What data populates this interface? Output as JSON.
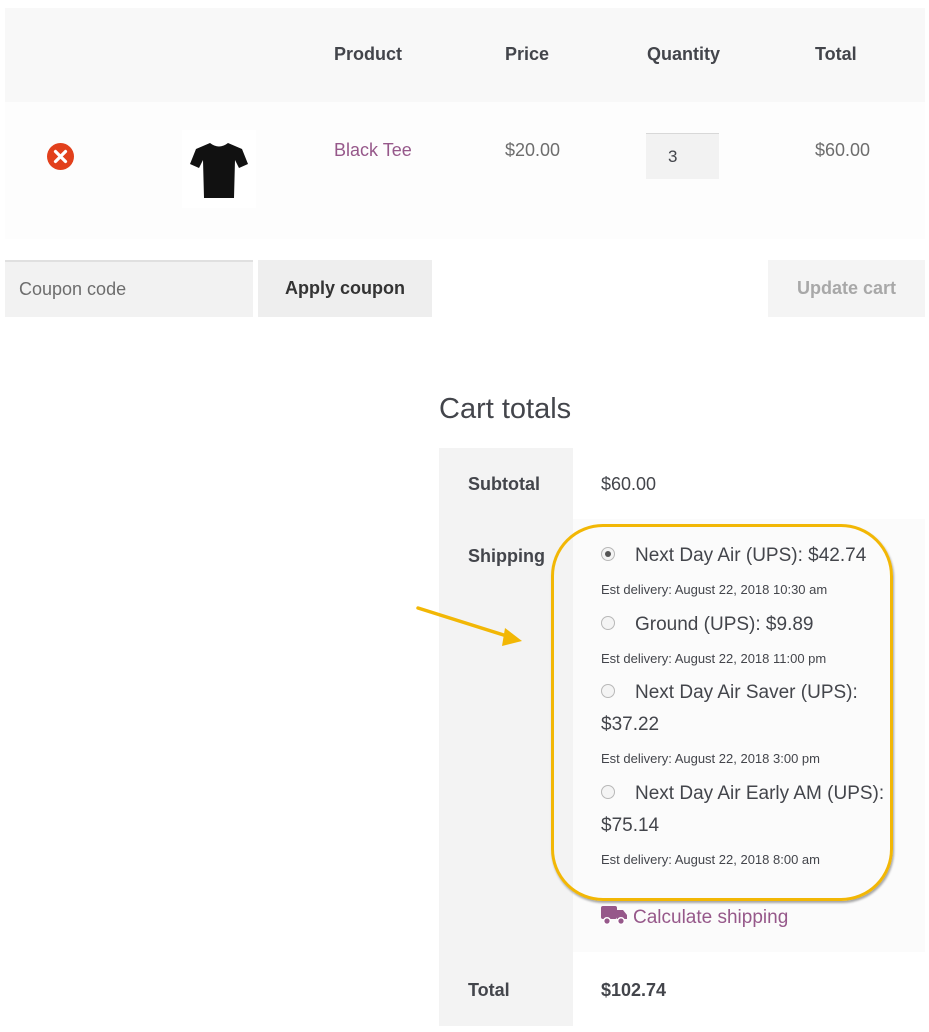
{
  "cart": {
    "headers": {
      "product": "Product",
      "price": "Price",
      "quantity": "Quantity",
      "total": "Total"
    },
    "items": [
      {
        "name": "Black Tee",
        "price": "$20.00",
        "quantity": "3",
        "total": "$60.00",
        "thumbnail_icon": "black-tshirt-image",
        "remove_icon": "close-circle-icon"
      }
    ],
    "coupon": {
      "placeholder": "Coupon code",
      "apply_label": "Apply coupon"
    },
    "update_label": "Update cart"
  },
  "totals": {
    "title": "Cart totals",
    "subtotal_label": "Subtotal",
    "subtotal_value": "$60.00",
    "shipping_label": "Shipping",
    "shipping_options": [
      {
        "label": "Next Day Air (UPS): $42.74",
        "delivery": "Est delivery: August 22, 2018 10:30 am",
        "selected": true
      },
      {
        "label": "Ground (UPS): $9.89",
        "delivery": "Est delivery: August 22, 2018 11:00 pm",
        "selected": false
      },
      {
        "label_line1": "Next Day Air Saver (UPS):",
        "label_line2": "$37.22",
        "delivery": "Est delivery: August 22, 2018 3:00 pm",
        "selected": false
      },
      {
        "label_line1": "Next Day Air Early AM (UPS):",
        "label_line2": "$75.14",
        "delivery": "Est delivery: August 22, 2018 8:00 am",
        "selected": false
      }
    ],
    "calculate_shipping_label": "Calculate shipping",
    "calculate_shipping_icon": "truck-icon",
    "total_label": "Total",
    "total_value": "$102.74"
  },
  "annotation": {
    "arrow_icon": "arrow-icon",
    "highlight_color": "#f2b705"
  },
  "colors": {
    "link": "#96588a",
    "remove": "#e2401c"
  }
}
